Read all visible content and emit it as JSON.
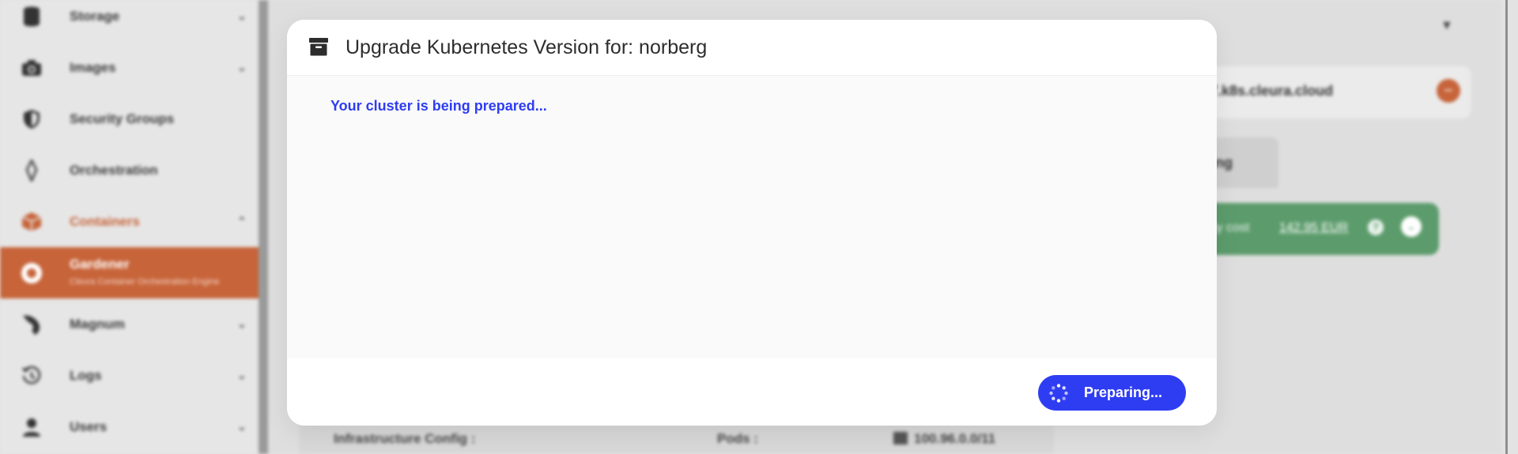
{
  "sidebar": {
    "items": [
      {
        "label": "Storage",
        "icon": "database-icon"
      },
      {
        "label": "Images",
        "icon": "camera-icon"
      },
      {
        "label": "Security Groups",
        "icon": "shield-icon"
      },
      {
        "label": "Orchestration",
        "icon": "orchestration-icon"
      },
      {
        "label": "Containers",
        "icon": "cube-icon"
      },
      {
        "label": "Gardener",
        "sublabel": "Cleura Container Orchestration Engine",
        "icon": "gardener-icon"
      },
      {
        "label": "Magnum",
        "icon": "magnum-icon"
      },
      {
        "label": "Logs",
        "icon": "history-icon"
      },
      {
        "label": "Users",
        "icon": "user-icon"
      }
    ]
  },
  "background": {
    "cluster_url": "7.k8s.cleura.cloud",
    "tab_label": "ing",
    "cost_label": "ly cost",
    "cost_value": "142.95 EUR",
    "infrastructure_label": "Infrastructure Config :",
    "pods_label": "Pods :",
    "pods_cidr": "100.96.0.0/11"
  },
  "modal": {
    "title": "Upgrade Kubernetes Version for: norberg",
    "status": "Your cluster is being prepared...",
    "button_label": "Preparing..."
  },
  "colors": {
    "accent": "#2f3df2",
    "brand_orange": "#c7643a",
    "cost_green": "#5c9c6c"
  }
}
